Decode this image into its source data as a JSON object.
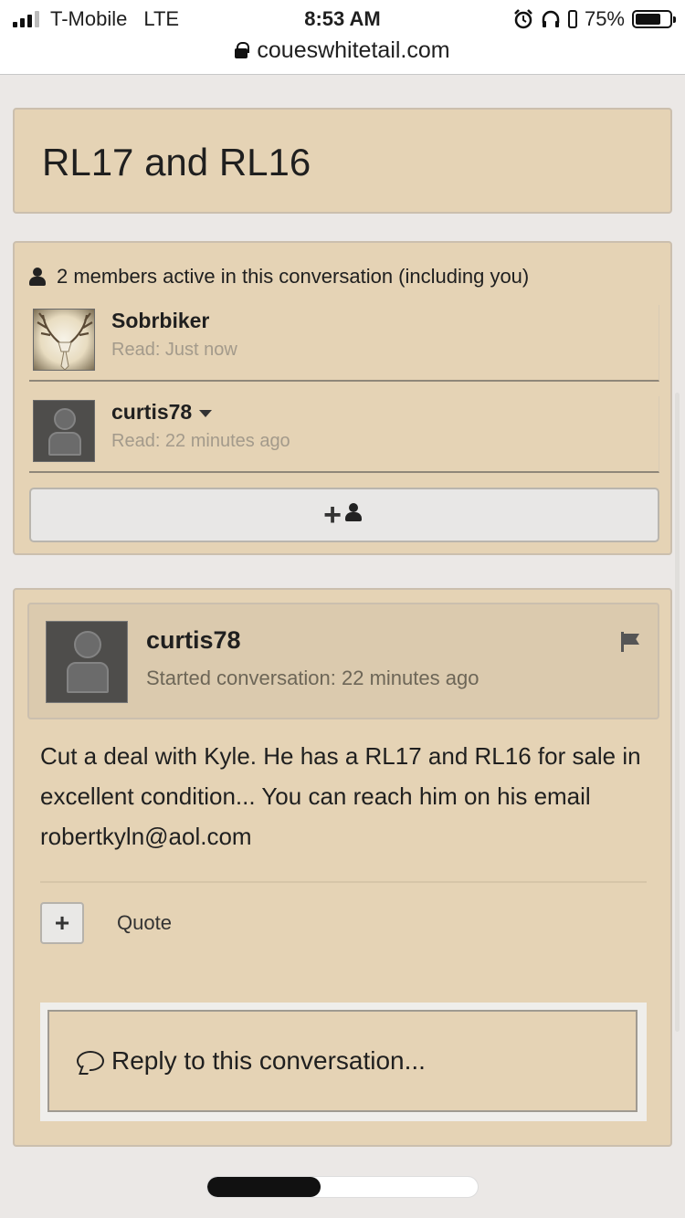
{
  "status_bar": {
    "carrier": "T-Mobile",
    "network": "LTE",
    "time": "8:53 AM",
    "battery": "75%",
    "icons": [
      "signal-icon",
      "alarm-icon",
      "headphones-icon",
      "battery-icon"
    ]
  },
  "url_bar": {
    "domain": "coueswhitetail.com",
    "icon": "lock-icon"
  },
  "conversation": {
    "title": "RL17 and RL16"
  },
  "members": {
    "heading": "2 members active in this conversation (including you)",
    "list": [
      {
        "name": "Sobrbiker",
        "read": "Read: Just now",
        "avatar": "antler-skull-avatar"
      },
      {
        "name": "curtis78",
        "read": "Read: 22 minutes ago",
        "avatar": "default-avatar"
      }
    ],
    "add_button_icon": "add-member-icon"
  },
  "message": {
    "author": "curtis78",
    "started": "Started conversation: 22 minutes ago",
    "body": "Cut a deal with Kyle. He has a RL17 and RL16 for sale in excellent condition... You can reach him on his email robertkyln@aol.com",
    "expand_label": "+",
    "quote_label": "Quote",
    "flag_icon": "flag-icon"
  },
  "reply": {
    "placeholder": "Reply to this conversation..."
  },
  "reading_progress": {
    "fraction": 0.42
  },
  "colors": {
    "panel": "#e5d3b5",
    "background": "#ebe8e6",
    "header_panel": "#dbcaae"
  }
}
